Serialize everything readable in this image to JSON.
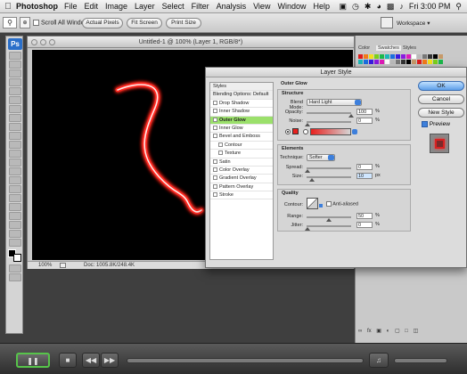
{
  "menubar": {
    "app": "Photoshop",
    "items": [
      "File",
      "Edit",
      "Image",
      "Layer",
      "Select",
      "Filter",
      "Analysis",
      "View",
      "Window",
      "Help"
    ],
    "clock": "Fri 3:00 PM"
  },
  "optionsbar": {
    "scroll_all": "Scroll All Windows",
    "actual_pixels": "Actual Pixels",
    "fit_screen": "Fit Screen",
    "print_size": "Print Size",
    "workspace": "Workspace"
  },
  "document": {
    "title": "Untitled-1 @ 100% (Layer 1, RGB/8*)",
    "zoom": "100%",
    "doc_info": "Doc: 1005.8K/248.4K"
  },
  "panels": {
    "tabs": [
      "Color",
      "Swatches",
      "Styles"
    ]
  },
  "dialog": {
    "title": "Layer Style",
    "styles": [
      {
        "label": "Styles",
        "kind": "header"
      },
      {
        "label": "Blending Options: Default",
        "kind": "header"
      },
      {
        "label": "Drop Shadow",
        "kind": "item"
      },
      {
        "label": "Inner Shadow",
        "kind": "item"
      },
      {
        "label": "Outer Glow",
        "kind": "active"
      },
      {
        "label": "Inner Glow",
        "kind": "item"
      },
      {
        "label": "Bevel and Emboss",
        "kind": "item"
      },
      {
        "label": "Contour",
        "kind": "indent"
      },
      {
        "label": "Texture",
        "kind": "indent"
      },
      {
        "label": "Satin",
        "kind": "item"
      },
      {
        "label": "Color Overlay",
        "kind": "item"
      },
      {
        "label": "Gradient Overlay",
        "kind": "item"
      },
      {
        "label": "Pattern Overlay",
        "kind": "item"
      },
      {
        "label": "Stroke",
        "kind": "item"
      }
    ],
    "section_title": "Outer Glow",
    "structure": {
      "label": "Structure",
      "blend_mode_label": "Blend Mode:",
      "blend_mode": "Hard Light",
      "opacity_label": "Opacity:",
      "opacity": "100",
      "noise_label": "Noise:",
      "noise": "0",
      "pct": "%",
      "glow_color": "#e8201e"
    },
    "elements": {
      "label": "Elements",
      "technique_label": "Technique:",
      "technique": "Softer",
      "spread_label": "Spread:",
      "spread": "0",
      "size_label": "Size:",
      "size": "10",
      "px": "px"
    },
    "quality": {
      "label": "Quality",
      "contour_label": "Contour:",
      "anti_aliased": "Anti-aliased",
      "range_label": "Range:",
      "range": "50",
      "jitter_label": "Jitter:",
      "jitter": "0"
    },
    "buttons": {
      "ok": "OK",
      "cancel": "Cancel",
      "new_style": "New Style",
      "preview": "Preview"
    }
  }
}
